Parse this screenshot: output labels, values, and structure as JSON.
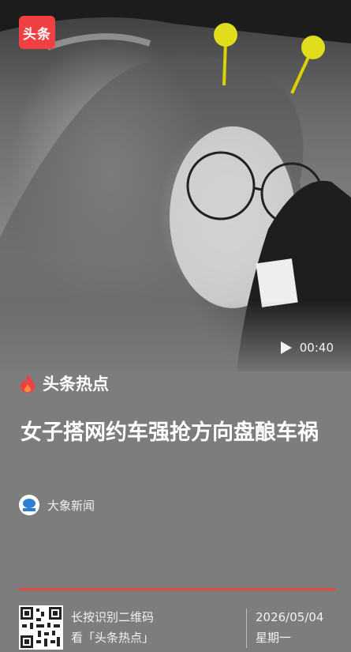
{
  "app": {
    "logo_text": "头条"
  },
  "video": {
    "duration": "00:40"
  },
  "section": {
    "label": "头条热点"
  },
  "article": {
    "headline": "女子搭网约车强抢方向盘酿车祸",
    "source": "大象新闻"
  },
  "footer": {
    "scan_line1": "长按识别二维码",
    "scan_line2": "看「头条热点」",
    "date": "2026/05/04",
    "weekday": "星期一"
  },
  "colors": {
    "brand_red": "#f04142",
    "divider_red": "#e6473f",
    "background": "#7d7d7d"
  },
  "icons": [
    "play-icon",
    "flame-icon",
    "source-avatar-icon",
    "qr-code"
  ]
}
